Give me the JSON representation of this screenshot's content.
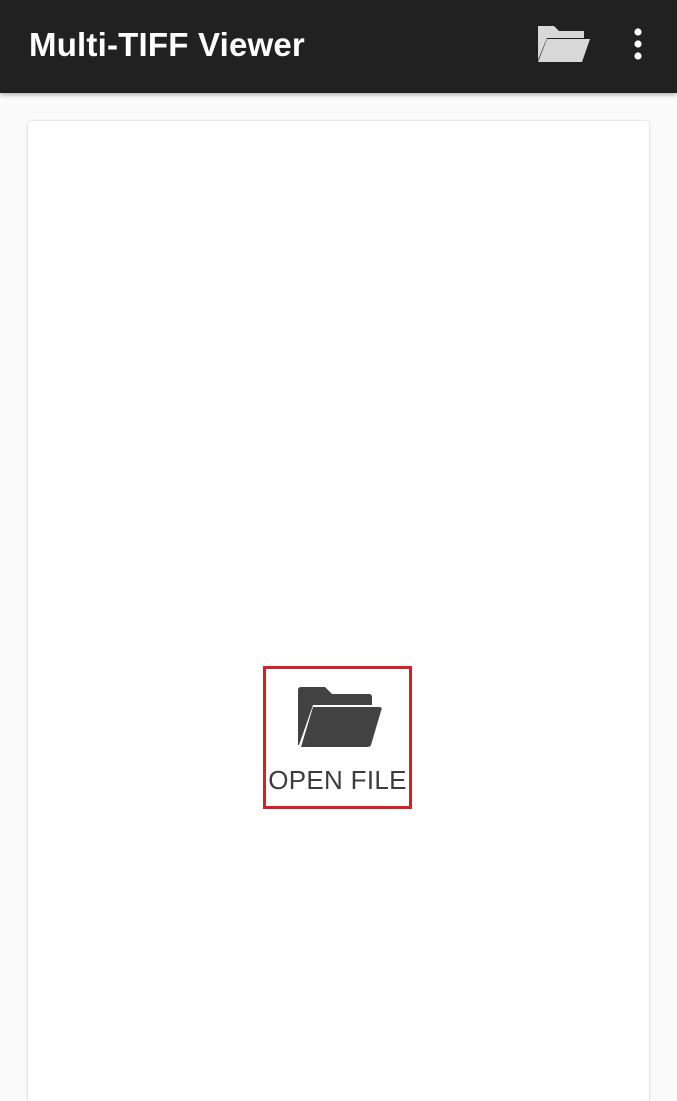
{
  "app_bar": {
    "title": "Multi-TIFF Viewer",
    "open_action_icon": "folder-open-icon",
    "overflow_menu_icon": "more-vert-icon"
  },
  "main": {
    "open_file": {
      "label": "OPEN FILE",
      "icon": "folder-icon"
    }
  },
  "colors": {
    "app_bar_background": "#212121",
    "app_bar_icon": "#d9d9d9",
    "highlight_border": "#d61f26",
    "folder_icon": "#424242",
    "page_background": "#fafafa",
    "card_background": "#ffffff"
  }
}
